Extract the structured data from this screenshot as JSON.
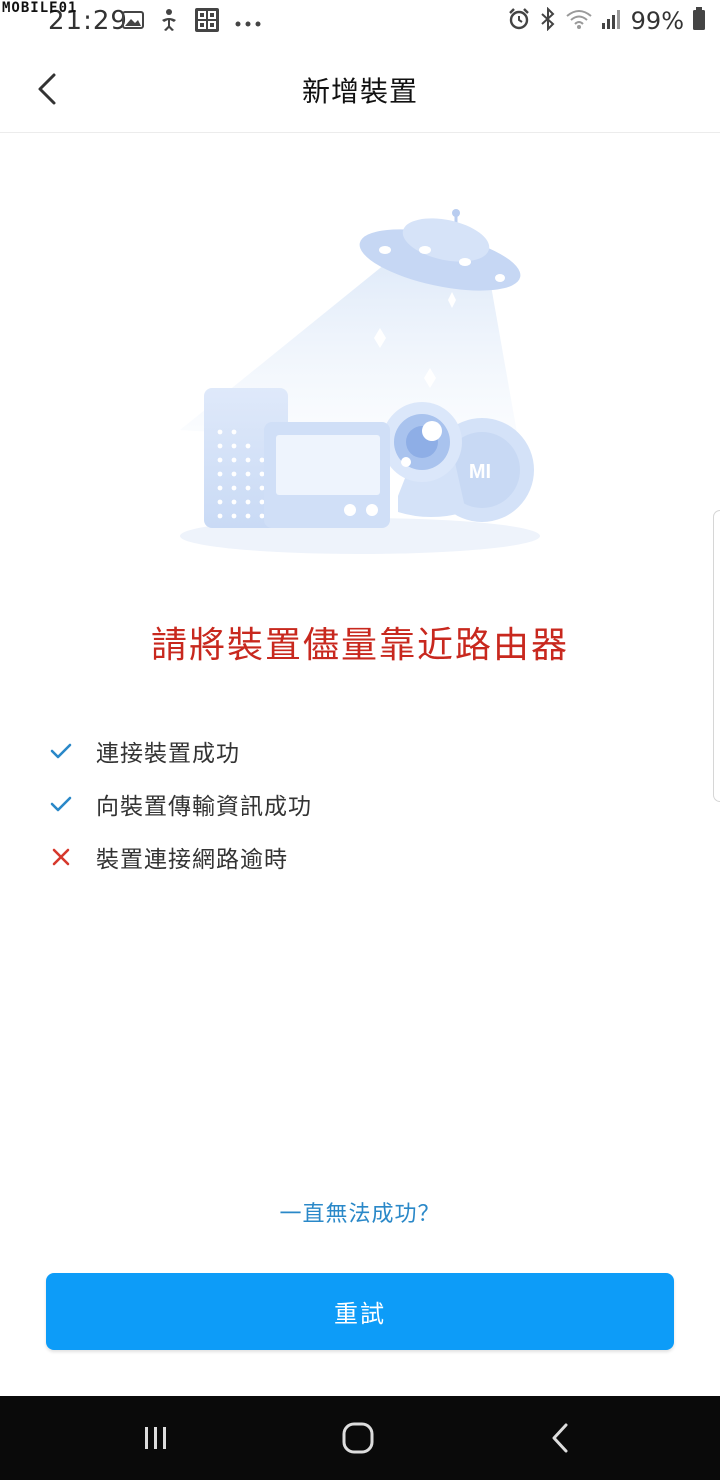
{
  "status_bar": {
    "time": "21:29",
    "watermark": "MOBILE01",
    "battery": "99%",
    "left_icons": [
      "image-icon",
      "accessibility-icon",
      "qr-app-icon",
      "more-dots-icon"
    ],
    "right_icons": [
      "alarm-icon",
      "bluetooth-icon",
      "wifi-icon",
      "signal-icon",
      "battery-icon"
    ]
  },
  "header": {
    "title": "新增裝置",
    "back_icon": "chevron-left-icon"
  },
  "illustration": {
    "icon": "ufo-devices-illustration",
    "logo_text": "MI"
  },
  "main": {
    "heading": "請將裝置儘量靠近路由器",
    "heading_color": "#c8281e",
    "steps": [
      {
        "label": "連接裝置成功",
        "status": "success",
        "icon": "check-icon"
      },
      {
        "label": "向裝置傳輸資訊成功",
        "status": "success",
        "icon": "check-icon"
      },
      {
        "label": "裝置連接網路逾時",
        "status": "failed",
        "icon": "cross-icon"
      }
    ],
    "success_color": "#2a88c8",
    "fail_color": "#d6382c",
    "help_link": "一直無法成功？",
    "retry_button": "重試",
    "accent_color": "#0d9cf8"
  },
  "nav_bar": {
    "buttons": [
      "recent-apps-icon",
      "home-icon",
      "back-icon"
    ]
  }
}
